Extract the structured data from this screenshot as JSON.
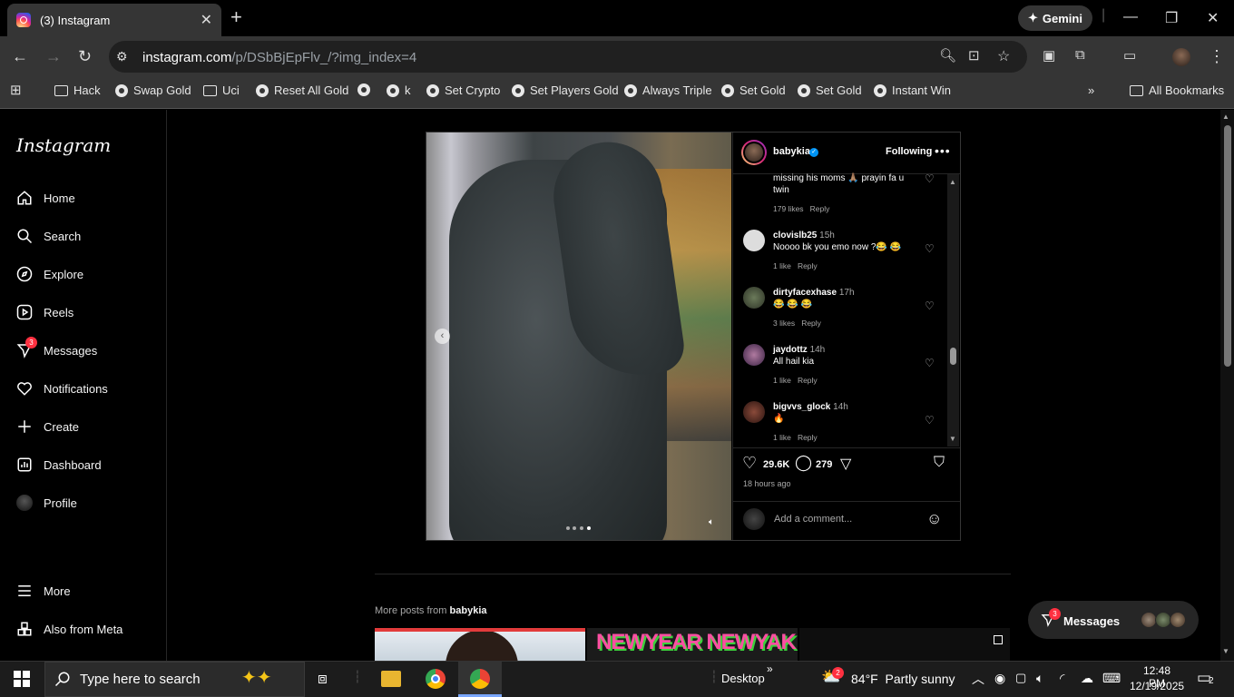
{
  "browser": {
    "tab_title": "(3) Instagram",
    "new_tab": "+",
    "gemini_label": "Gemini",
    "url_host": "instagram.com",
    "url_path": "/p/DSbBjEpFlv_/?img_index=4",
    "bookmarks": [
      {
        "label": "Hack",
        "icon": "folder-icon"
      },
      {
        "label": "Swap Gold",
        "icon": "globe-icon"
      },
      {
        "label": "Uci",
        "icon": "folder-icon"
      },
      {
        "label": "Reset All Gold",
        "icon": "globe-icon"
      },
      {
        "label": "",
        "icon": "globe-icon"
      },
      {
        "label": "k",
        "icon": "globe-icon"
      },
      {
        "label": "Set Crypto",
        "icon": "globe-icon"
      },
      {
        "label": "Set Players Gold",
        "icon": "globe-icon"
      },
      {
        "label": "Always Triple",
        "icon": "globe-icon"
      },
      {
        "label": "Set Gold",
        "icon": "globe-icon"
      },
      {
        "label": "Set Gold",
        "icon": "globe-icon"
      },
      {
        "label": "Instant Win",
        "icon": "globe-icon"
      }
    ],
    "all_bookmarks": "All Bookmarks"
  },
  "sidebar": {
    "logo": "Instagram",
    "items": [
      {
        "label": "Home",
        "icon": "home-icon"
      },
      {
        "label": "Search",
        "icon": "search-icon"
      },
      {
        "label": "Explore",
        "icon": "compass-icon"
      },
      {
        "label": "Reels",
        "icon": "reels-icon"
      },
      {
        "label": "Messages",
        "icon": "messenger-icon",
        "badge": "3"
      },
      {
        "label": "Notifications",
        "icon": "heart-icon"
      },
      {
        "label": "Create",
        "icon": "plus-icon"
      },
      {
        "label": "Dashboard",
        "icon": "dashboard-icon"
      },
      {
        "label": "Profile",
        "icon": "avatar"
      }
    ],
    "more": "More",
    "also_from_meta": "Also from Meta"
  },
  "post": {
    "username": "babykia",
    "following": "Following",
    "comments": [
      {
        "user": "",
        "time": "",
        "text": "missing his moms 🙏🏽 prayin fa u twin",
        "likes": "179 likes",
        "reply": "Reply"
      },
      {
        "user": "clovislb25",
        "time": "15h",
        "text": "Noooo bk you emo now ?😂 😂",
        "likes": "1 like",
        "reply": "Reply"
      },
      {
        "user": "dirtyfacexhase",
        "time": "17h",
        "text": "😂 😂 😂",
        "likes": "3 likes",
        "reply": "Reply"
      },
      {
        "user": "jaydottz",
        "time": "14h",
        "text": "All hail kia",
        "likes": "1 like",
        "reply": "Reply"
      },
      {
        "user": "bigvvs_glock",
        "time": "14h",
        "text": "🔥",
        "likes": "1 like",
        "reply": "Reply"
      }
    ],
    "like_count": "29.6K",
    "comment_count": "279",
    "posted_ago": "18 hours ago",
    "add_comment_placeholder": "Add a comment..."
  },
  "more_posts": {
    "prefix": "More posts from ",
    "user": "babykia",
    "thumb2_text": "NEWYEAR NEWYAK"
  },
  "messages_pill": {
    "label": "Messages",
    "badge": "3"
  },
  "taskbar": {
    "search_placeholder": "Type here to search",
    "desktop": "Desktop",
    "weather_badge": "2",
    "weather": "84°F  Partly sunny",
    "time": "12:48 PM",
    "date": "12/19/2025",
    "notif_count": "2"
  },
  "colors": {
    "accent_blue": "#0095f6",
    "badge_red": "#ff3040",
    "chrome_gray": "#353535"
  }
}
